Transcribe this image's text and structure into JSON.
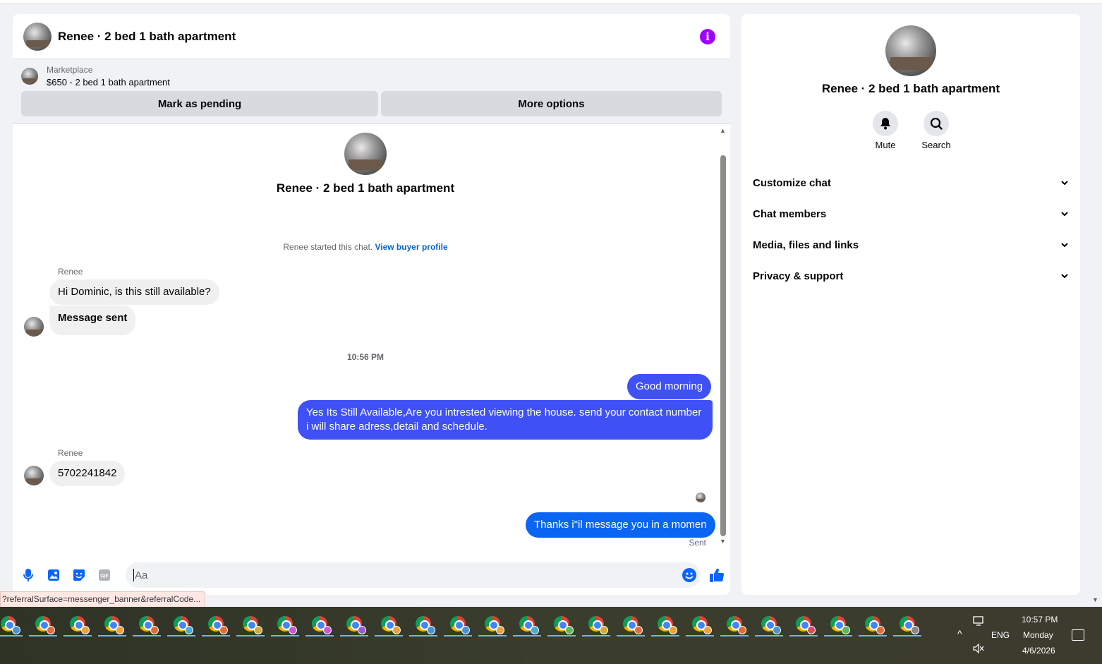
{
  "header": {
    "title": "Renee · 2 bed 1 bath apartment"
  },
  "marketplace": {
    "source": "Marketplace",
    "listing": "$650 - 2 bed 1 bath apartment",
    "mark_pending_label": "Mark as pending",
    "more_options_label": "More options"
  },
  "intro": {
    "name": "Renee · 2 bed 1 bath apartment",
    "started_text": "Renee started this chat.",
    "view_profile_link": "View buyer profile"
  },
  "messages": [
    {
      "sender": "Renee",
      "text": "Hi Dominic, is this still available?",
      "direction": "in"
    },
    {
      "sender": "",
      "text": "Message sent",
      "direction": "in"
    },
    {
      "timestamp": "10:56 PM"
    },
    {
      "text": "Good morning",
      "direction": "out"
    },
    {
      "text": "Yes Its Still Available,Are you intrested viewing the house. send your contact number i will share adress,detail and schedule.",
      "direction": "out"
    },
    {
      "sender": "Renee",
      "text": "5702241842",
      "direction": "in"
    },
    {
      "text": "Thanks i\"il message you in a momen",
      "direction": "out"
    },
    {
      "status": "Sent"
    }
  ],
  "composer": {
    "placeholder": "Aa"
  },
  "status_bar_url": "?referralSurface=messenger_banner&referralCode...",
  "side": {
    "name": "Renee · 2 bed 1 bath apartment",
    "actions": [
      {
        "label": "Mute",
        "icon": "bell-icon"
      },
      {
        "label": "Search",
        "icon": "search-icon"
      }
    ],
    "sections": [
      {
        "label": "Customize chat"
      },
      {
        "label": "Chat members"
      },
      {
        "label": "Media, files and links"
      },
      {
        "label": "Privacy & support"
      }
    ]
  },
  "taskbar": {
    "app_count": 27,
    "app_icon": "chrome-icon",
    "profile_colors": [
      "#4a90d9",
      "#e26b3a",
      "#e8a33d",
      "#e8a33d",
      "#e26b3a",
      "#4aa8d9",
      "#e26b3a",
      "#d4a83a",
      "#c85ad6",
      "#c85ad6",
      "#9a5ad6",
      "#e8a33d",
      "#4a90d9",
      "#4a90d9",
      "#e8a33d",
      "#4aa8d9",
      "#5ab85a",
      "#d4a83a",
      "#e26b3a",
      "#e8a33d",
      "#e8a33d",
      "#e26b3a",
      "#4a90d9",
      "#d6497a",
      "#5ab85a",
      "#e26b3a",
      "#888888"
    ],
    "language": "ENG",
    "time": "10:57 PM",
    "day": "Monday",
    "date": "4/6/2026"
  },
  "colors": {
    "outgoing_bubble": "#3f51f5",
    "outgoing_bubble_latest": "#0a66f2",
    "link": "#0064d1",
    "info_icon": "#a100ff",
    "composer_icons": "#0866ff"
  }
}
